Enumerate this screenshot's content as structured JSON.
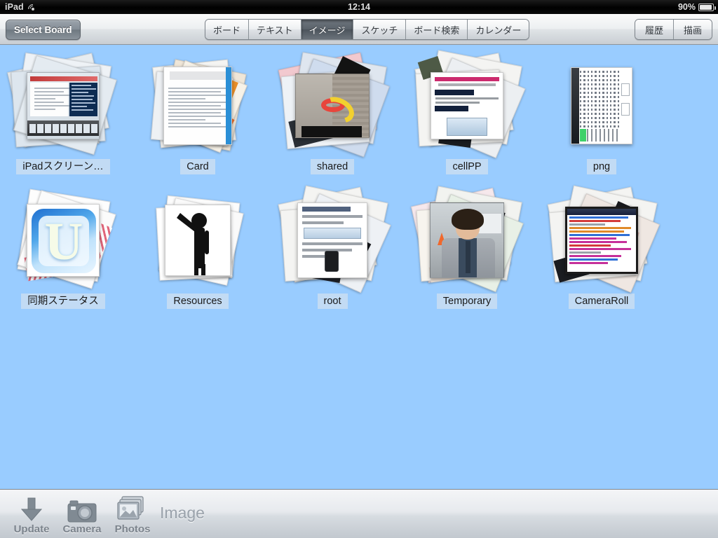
{
  "status_bar": {
    "carrier": "iPad",
    "wifi_icon": "wifi-icon",
    "time": "12:14",
    "battery_percent": "90%",
    "battery_icon": "battery-icon"
  },
  "toolbar": {
    "select_board_label": "Select Board",
    "segmented": [
      {
        "label": "ボード",
        "selected": false
      },
      {
        "label": "テキスト",
        "selected": false
      },
      {
        "label": "イメージ",
        "selected": true
      },
      {
        "label": "スケッチ",
        "selected": false
      },
      {
        "label": "ボード検索",
        "selected": false
      },
      {
        "label": "カレンダー",
        "selected": false
      }
    ],
    "right_buttons": [
      {
        "label": "履歴"
      },
      {
        "label": "描画"
      }
    ]
  },
  "content": {
    "background_color": "#99ccff",
    "rows": [
      [
        {
          "label": "iPadスクリーン…",
          "thumb": "ipad-screenshot-stack"
        },
        {
          "label": "Card",
          "thumb": "card-document-stack"
        },
        {
          "label": "shared",
          "thumb": "shared-photo-stack"
        },
        {
          "label": "cellPP",
          "thumb": "cellpp-slide-stack"
        },
        {
          "label": "png",
          "thumb": "png-vertical-text"
        }
      ],
      [
        {
          "label": "同期ステータス",
          "thumb": "sync-status-u-logo"
        },
        {
          "label": "Resources",
          "thumb": "resources-person-icon"
        },
        {
          "label": "root",
          "thumb": "root-documents-stack"
        },
        {
          "label": "Temporary",
          "thumb": "temporary-portrait-stack"
        },
        {
          "label": "CameraRoll",
          "thumb": "cameraroll-window-stack"
        }
      ]
    ]
  },
  "bottom_bar": {
    "items": [
      {
        "label": "Update",
        "icon": "download-arrow-icon"
      },
      {
        "label": "Camera",
        "icon": "camera-icon"
      },
      {
        "label": "Photos",
        "icon": "photos-icon"
      }
    ],
    "title": "Image"
  }
}
